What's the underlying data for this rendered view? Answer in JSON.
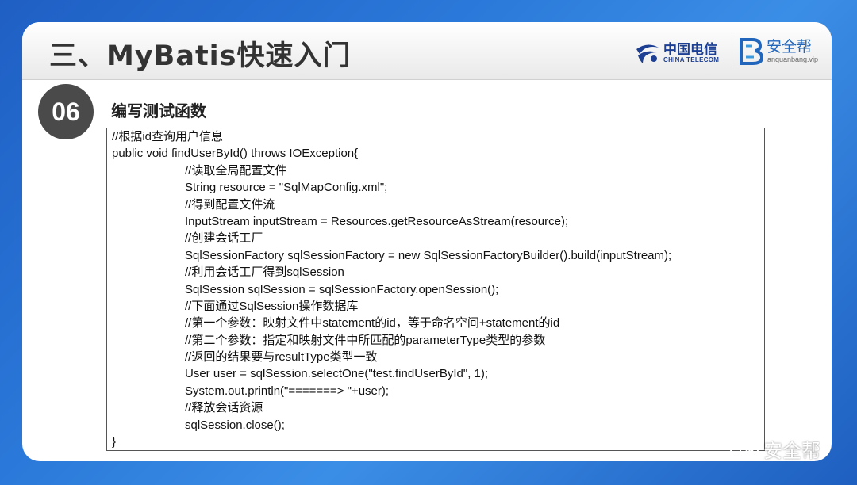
{
  "header": {
    "title": "三、MyBatis快速入门",
    "logo_ct_cn": "中国电信",
    "logo_ct_en": "CHINA TELECOM",
    "logo_aq_cn": "安全帮",
    "logo_aq_en": "anquanbang.vip"
  },
  "section": {
    "number": "06",
    "title": "编写测试函数"
  },
  "code": {
    "lines": [
      "//根据id查询用户信息",
      "public void findUserById() throws IOException{",
      "//读取全局配置文件",
      "String resource = \"SqlMapConfig.xml\";",
      "//得到配置文件流",
      "InputStream inputStream = Resources.getResourceAsStream(resource);",
      "//创建会话工厂",
      "SqlSessionFactory sqlSessionFactory = new SqlSessionFactoryBuilder().build(inputStream);",
      "//利用会话工厂得到sqlSession",
      "SqlSession sqlSession = sqlSessionFactory.openSession();",
      "//下面通过SqlSession操作数据库",
      "//第一个参数：映射文件中statement的id，等于命名空间+statement的id",
      "//第二个参数：指定和映射文件中所匹配的parameterType类型的参数",
      "//返回的结果要与resultType类型一致",
      "User user = sqlSession.selectOne(\"test.findUserById\", 1);",
      "System.out.println(\"=======> \"+user);",
      "//释放会话资源",
      "sqlSession.close();",
      "}"
    ]
  },
  "watermark": {
    "text": "安全帮"
  }
}
